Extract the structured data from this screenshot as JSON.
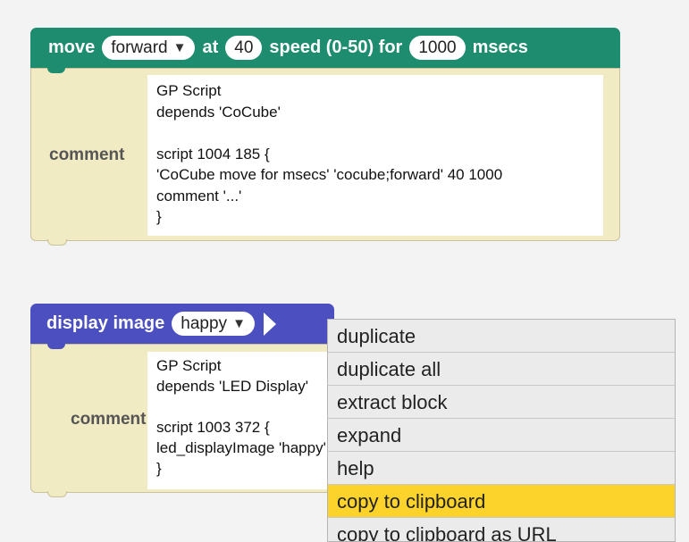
{
  "block1": {
    "color": "#1e8c6f",
    "label_move": "move",
    "direction": "forward",
    "label_at": "at",
    "speed_value": "40",
    "label_speed": "speed (0-50) for",
    "msecs_value": "1000",
    "label_msecs": "msecs",
    "comment_label": "comment",
    "comment_text": "GP Script\ndepends 'CoCube'\n\nscript 1004 185 {\n'CoCube move for msecs' 'cocube;forward' 40 1000\ncomment '...'\n}"
  },
  "block2": {
    "color": "#4c4fc0",
    "label_display": "display image",
    "image": "happy",
    "comment_label": "comment",
    "comment_text": "GP Script\ndepends 'LED Display'\n\nscript 1003 372 {\nled_displayImage 'happy'\n}"
  },
  "menu": {
    "items": [
      {
        "label": "duplicate"
      },
      {
        "label": "duplicate all"
      },
      {
        "label": "extract block"
      },
      {
        "label": "expand"
      },
      {
        "label": "help"
      },
      {
        "label": "copy to clipboard",
        "selected": true
      },
      {
        "label": "copy to clipboard as URL"
      }
    ],
    "highlight_color": "#fbd32b"
  }
}
